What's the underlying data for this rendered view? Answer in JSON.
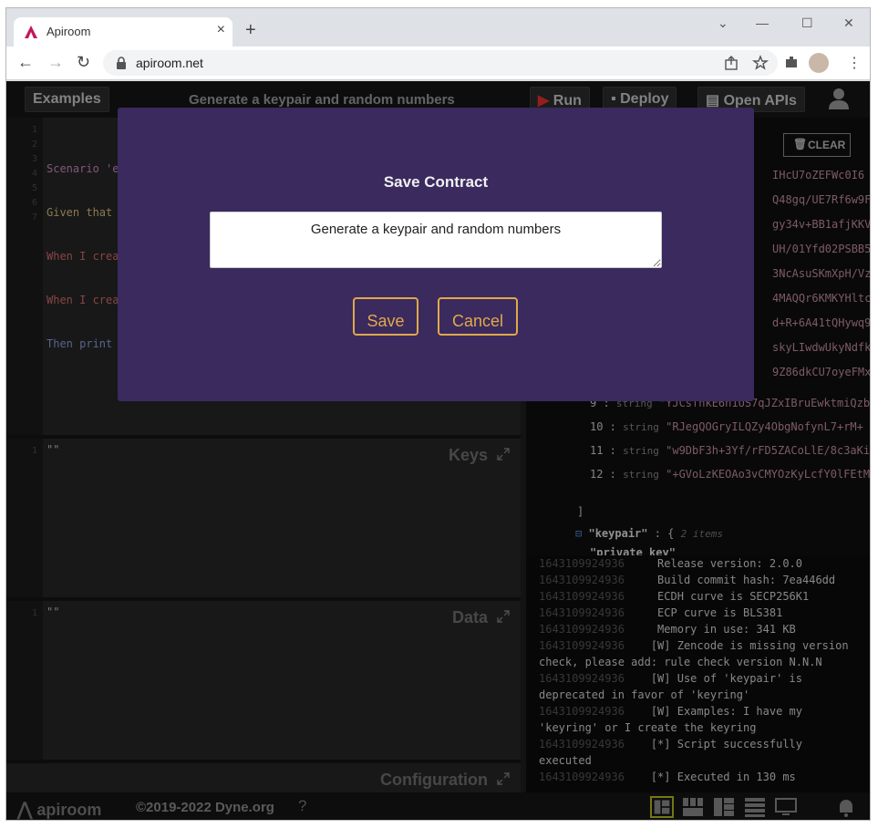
{
  "browser": {
    "tab_title": "Apiroom",
    "url": "apiroom.net"
  },
  "app": {
    "examples_label": "Examples",
    "contract_title": "Generate a keypair and random numbers",
    "run_label": "Run",
    "deploy_label": "Deploy",
    "open_apis_label": "Open APIs",
    "clear_label": "CLEAR",
    "editor_lines": [
      "Scenario 'e",
      "Given that",
      "When I crea",
      "When I crea",
      "Then print"
    ],
    "keys_label": "Keys",
    "keys_content": "\"\"",
    "data_label": "Data",
    "data_content": "\"\"",
    "configuration_label": "Configuration",
    "brand": "apiroom",
    "copyright": "©2019-2022 Dyne.org",
    "colors": {
      "accent": "#e1a84a",
      "modal_bg": "#3a2a5e",
      "app_bg": "#1e1e1e"
    }
  },
  "json_view": {
    "right_fragments": [
      "IHcU7oZEFWc0I6",
      "Q48gq/UE7Rf6w9F",
      "gy34v+BB1afjKKV",
      "UH/01Yfd02PSBB5",
      "3NcAsuSKmXpH/Vz",
      "4MAQQr6KMKYHltc",
      "d+R+6A41tQHywq9",
      "skyLIwdwUkyNdfk",
      "9Z86dkCU7oyeFMx"
    ],
    "items": [
      {
        "index": "9",
        "type": "string",
        "value": "\"YJCsfhkE6n1US7qJZxIBruEwktmiQzb"
      },
      {
        "index": "10",
        "type": "string",
        "value": "\"RJegQOGryILQZy4ObgNofynL7+rM+"
      },
      {
        "index": "11",
        "type": "string",
        "value": "\"w9DbF3h+3Yf/rFD5ZACoLlE/8c3aKi"
      },
      {
        "index": "12",
        "type": "string",
        "value": "\"+GVoLzKEOAo3vCMYOzKyLcfY0lFEtM"
      }
    ],
    "bracket_close": "]",
    "keypair_key": "\"keypair\"",
    "keypair_meta": "2 items",
    "private_key_partial": "\"private_key\""
  },
  "console": {
    "lines": [
      {
        "ts": "1643109924936",
        "msg": "Release version: 2.0.0"
      },
      {
        "ts": "1643109924936",
        "msg": "Build commit hash: 7ea446dd"
      },
      {
        "ts": "1643109924936",
        "msg": "ECDH curve is SECP256K1"
      },
      {
        "ts": "1643109924936",
        "msg": "ECP curve is BLS381"
      },
      {
        "ts": "1643109924936",
        "msg": "Memory in use: 341 KB"
      },
      {
        "ts": "1643109924936",
        "msg": "[W] Zencode is missing version",
        "cont": "check, please add: rule check version N.N.N"
      },
      {
        "ts": "1643109924936",
        "msg": "[W] Use of 'keypair' is",
        "cont": "deprecated in favor of 'keyring'"
      },
      {
        "ts": "1643109924936",
        "msg": "[W] Examples: I have my",
        "cont": "'keyring' or I create the keyring"
      },
      {
        "ts": "1643109924936",
        "msg": "[*] Script successfully",
        "cont": "executed"
      },
      {
        "ts": "1643109924936",
        "msg": "[*] Executed in 130 ms"
      }
    ]
  },
  "modal": {
    "title": "Save Contract",
    "input_value": "Generate a keypair and random numbers",
    "save_label": "Save",
    "cancel_label": "Cancel"
  }
}
